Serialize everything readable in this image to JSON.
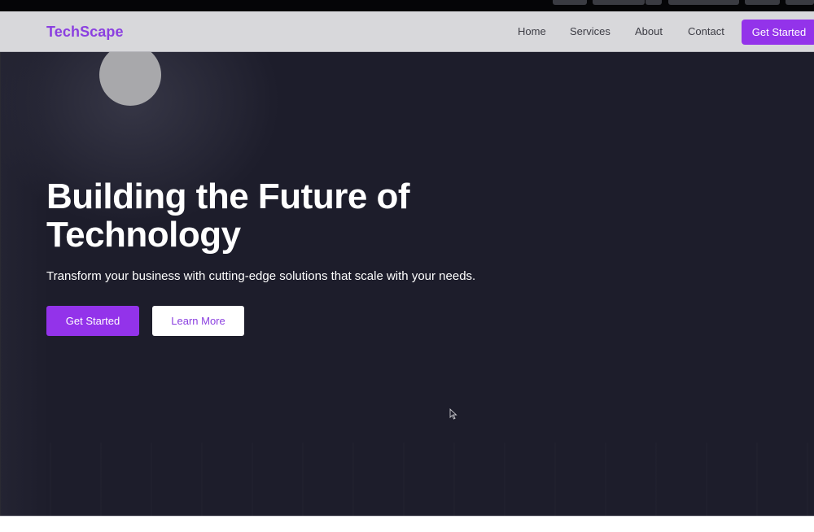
{
  "brand": {
    "name": "TechScape",
    "color": "#8b3fe0"
  },
  "nav": {
    "links": [
      {
        "label": "Home"
      },
      {
        "label": "Services"
      },
      {
        "label": "About"
      },
      {
        "label": "Contact"
      }
    ],
    "cta_label": "Get Started"
  },
  "hero": {
    "title_line1": "Building the Future of",
    "title_line2": "Technology",
    "subtitle": "Transform your business with cutting-edge solutions that scale with your needs.",
    "primary_button": "Get Started",
    "secondary_button": "Learn More"
  },
  "colors": {
    "accent": "#9333ea",
    "hero_background": "#1d1d2b",
    "navbar_background": "#d8d8db"
  },
  "icons": {
    "cursor": "mouse-pointer-icon",
    "moon": "moon-decoration"
  }
}
